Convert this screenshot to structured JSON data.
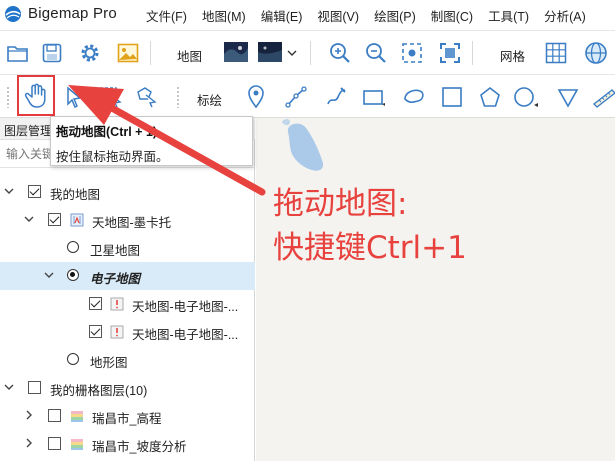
{
  "app": {
    "name": "Bigemap Pro"
  },
  "menu": [
    "文件(F)",
    "地图(M)",
    "编辑(E)",
    "视图(V)",
    "绘图(P)",
    "制图(C)",
    "工具(T)",
    "分析(A)"
  ],
  "toolbar1": {
    "map_label": "地图",
    "grid_label": "网格"
  },
  "toolbar2": {
    "annotate_label": "标绘"
  },
  "panel": {
    "title": "图层管理",
    "search_placeholder": "输入关键字进行过滤"
  },
  "tooltip": {
    "title": "拖动地图(Ctrl + 1)",
    "description": "按住鼠标拖动界面。"
  },
  "tree": [
    {
      "label": "我的地图",
      "checked": true
    },
    {
      "label": "天地图-墨卡托",
      "checked": true
    },
    {
      "label": "卫星地图",
      "selected": false
    },
    {
      "label": "电子地图",
      "selected": true
    },
    {
      "label": "天地图-电子地图-...",
      "checked": true
    },
    {
      "label": "天地图-电子地图-...",
      "checked": true
    },
    {
      "label": "地形图",
      "selected": false
    },
    {
      "label": "我的栅格图层(10)",
      "checked": false
    },
    {
      "label": "瑞昌市_高程",
      "checked": false
    },
    {
      "label": "瑞昌市_坡度分析",
      "checked": false
    }
  ],
  "annotation": {
    "line1": "拖动地图:",
    "line2": "快捷键Ctrl+1"
  },
  "colors": {
    "accent_red": "#e8423f",
    "selection": "#d9ebf9",
    "map_bg": "#f4f3ef",
    "water": "#abc9e8"
  }
}
